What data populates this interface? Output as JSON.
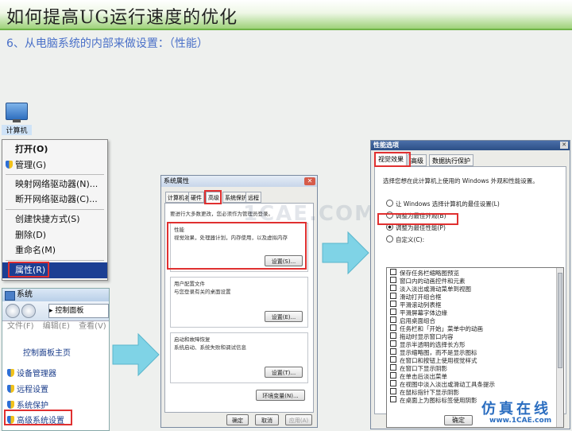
{
  "slide": {
    "title": "如何提高UG运行速度的优化",
    "subtitle": "6、从电脑系统的内部来做设置：（性能）"
  },
  "desktop_icon": {
    "label": "计算机",
    "icon": "computer-icon"
  },
  "context_menu": {
    "items": [
      {
        "label": "打开(O)",
        "bold": true,
        "shield": false
      },
      {
        "label": "管理(G)",
        "bold": false,
        "shield": true
      },
      {
        "label": "映射网络驱动器(N)...",
        "bold": false,
        "shield": false
      },
      {
        "label": "断开网络驱动器(C)...",
        "bold": false,
        "shield": false
      },
      {
        "label": "创建快捷方式(S)",
        "bold": false,
        "shield": false
      },
      {
        "label": "删除(D)",
        "bold": false,
        "shield": false
      },
      {
        "label": "重命名(M)",
        "bold": false,
        "shield": false
      },
      {
        "label": "属性(R)",
        "bold": false,
        "shield": false,
        "selected": true
      }
    ]
  },
  "control_panel": {
    "window_title": "系统",
    "address": "▸ 控制面板",
    "menu": [
      "文件(F)",
      "编辑(E)",
      "查看(V)"
    ],
    "home_link": "控制面板主页",
    "links": [
      "设备管理器",
      "远程设置",
      "系统保护",
      "高级系统设置"
    ]
  },
  "system_properties": {
    "title": "系统属性",
    "tabs": [
      "计算机名",
      "硬件",
      "高级",
      "系统保护",
      "远程"
    ],
    "active_tab": 2,
    "admin_note": "要进行大多数更改，您必须作为管理员登录。",
    "performance": {
      "heading": "性能",
      "desc": "视觉效果，处理器计划，内存使用，以及虚拟内存",
      "button": "设置(S)..."
    },
    "user_profile": {
      "heading": "用户配置文件",
      "desc": "与您登录有关的桌面设置",
      "button": "设置(E)..."
    },
    "startup": {
      "heading": "启动和故障恢复",
      "desc": "系统启动、系统失败和调试信息",
      "button": "设置(T)..."
    },
    "env_button": "环境变量(N)...",
    "footer_buttons": [
      "确定",
      "取消",
      "应用(A)"
    ]
  },
  "performance_options": {
    "title": "性能选项",
    "tabs": [
      "视觉效果",
      "高级",
      "数据执行保护"
    ],
    "description": "选择您想在此计算机上使用的 Windows 外观和性能设置。",
    "radios": [
      {
        "label": "让 Windows 选择计算机的最佳设置(L)",
        "checked": false
      },
      {
        "label": "调整为最佳外观(B)",
        "checked": false
      },
      {
        "label": "调整为最佳性能(P)",
        "checked": true
      },
      {
        "label": "自定义(C):",
        "checked": false
      }
    ],
    "checkboxes": [
      "保存任务栏缩略图预览",
      "窗口内的动画控件和元素",
      "淡入淡出或滑动菜单到视图",
      "滑动打开组合框",
      "平滑滚动列表框",
      "平滑屏幕字体边缘",
      "启用桌面组合",
      "任务栏和「开始」菜单中的动画",
      "拖动时显示窗口内容",
      "显示半透明的选择长方形",
      "显示缩略图，而不是显示图标",
      "在窗口和按钮上使用视觉样式",
      "在窗口下显示阴影",
      "在单击后淡出菜单",
      "在视图中淡入淡出或滑动工具条提示",
      "在鼠标指针下显示阴影",
      "在桌面上为图标标签使用阴影"
    ],
    "ok_button": "确定"
  },
  "watermark": "1CAE.COM",
  "logo": {
    "main": "仿真在线",
    "url": "www.1CAE.com"
  },
  "colors": {
    "highlight_box": "#e03030",
    "arrow": "#7fd3e6",
    "header_green": "#9ed27a",
    "menu_selected": "#1c3f93"
  }
}
